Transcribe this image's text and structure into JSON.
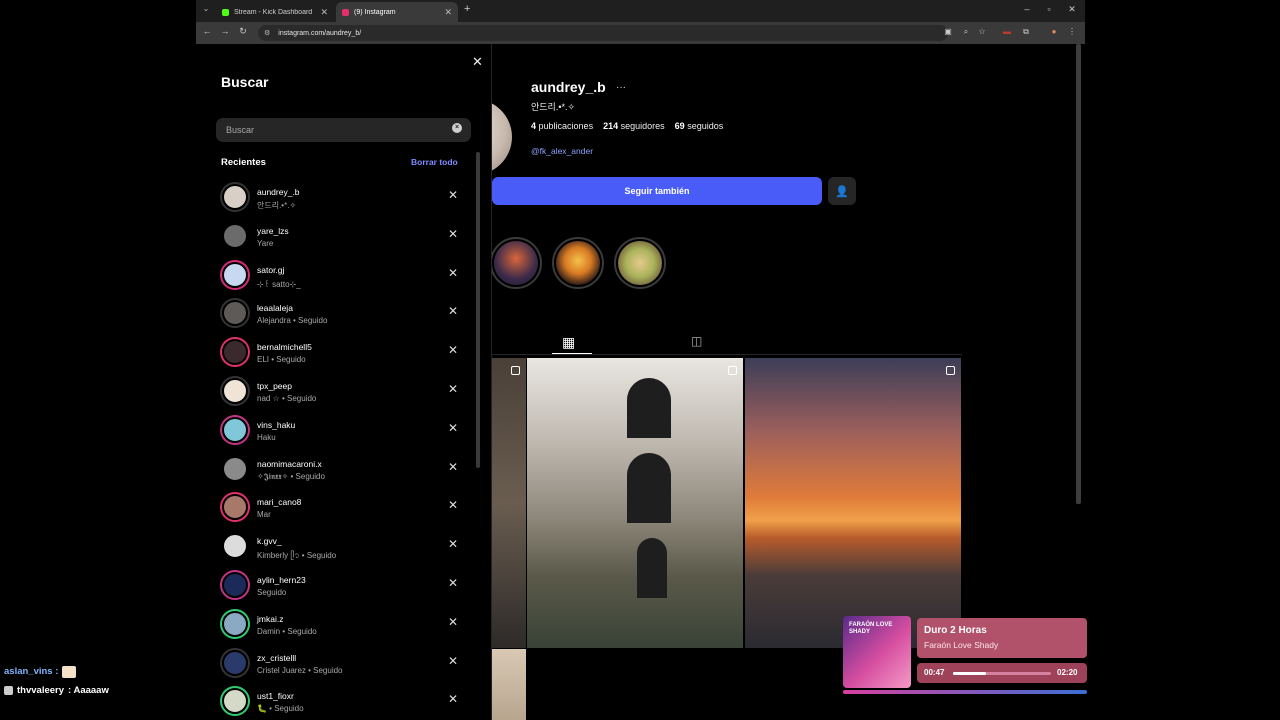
{
  "browser": {
    "tabs": [
      {
        "title": "Stream - Kick Dashboard",
        "favicon_color": "#53fc18"
      },
      {
        "title": "(9) Instagram",
        "favicon_color": "#e1306c"
      }
    ],
    "url": "instagram.com/aundrey_b/"
  },
  "search_panel": {
    "title": "Buscar",
    "search_placeholder": "Buscar",
    "recent_label": "Recientes",
    "clear_all_label": "Borrar todo",
    "recent": [
      {
        "user": "aundrey_.b",
        "sub": "안드리.•*.✧",
        "ring": "#333333",
        "color": "#d8cfc7"
      },
      {
        "user": "yare_lzs",
        "sub": "Yare",
        "ring": "#000000",
        "color": "#6b6b6b"
      },
      {
        "user": "sator.gj",
        "sub": "⊹꒰ satto⊹_",
        "ring": "#d62976",
        "color": "#c7d8f0"
      },
      {
        "user": "leaalaleja",
        "sub": "Alejandra • Seguido",
        "ring": "#333333",
        "color": "#5d5a58"
      },
      {
        "user": "bernalmichell5",
        "sub": "ELI • Seguido",
        "ring": "#e1306c",
        "color": "#3a2a2e"
      },
      {
        "user": "tpx_peep",
        "sub": "nad ☆ • Seguido",
        "ring": "#333333",
        "color": "#efe4d6"
      },
      {
        "user": "vins_haku",
        "sub": "Haku",
        "ring": "#c13584",
        "color": "#7fc7d9"
      },
      {
        "user": "naomimacaroni.x",
        "sub": "✧𝕵𝖎𝖓𝖝𝖝✧ • Seguido",
        "ring": "#000000",
        "color": "#8a8a8a"
      },
      {
        "user": "mari_cano8",
        "sub": "Mar",
        "ring": "#e1306c",
        "color": "#a8786a"
      },
      {
        "user": "k.gvv_",
        "sub": "Kimberly ᥫ᭡ • Seguido",
        "ring": "#000000",
        "color": "#dcdcdc"
      },
      {
        "user": "aylin_hern23",
        "sub": "Seguido",
        "ring": "#c13584",
        "color": "#1c2a5a"
      },
      {
        "user": "jmkai.z",
        "sub": "Damin • Seguido",
        "ring": "#2ecc71",
        "color": "#8aa9c2"
      },
      {
        "user": "zx_cristelll",
        "sub": "Cristel Juarez • Seguido",
        "ring": "#333333",
        "color": "#2a3a6a"
      },
      {
        "user": "ust1_fioxr",
        "sub": "🐛 • Seguido",
        "ring": "#2ecc71",
        "color": "#d5d9c8"
      }
    ]
  },
  "profile": {
    "username": "aundrey_.b",
    "display_name": "안드리.•*.✧",
    "posts_count": "4",
    "posts_label": "publicaciones",
    "followers_count": "214",
    "followers_label": "seguidores",
    "following_count": "69",
    "following_label": "seguidos",
    "mention": "@fk_alex_ander",
    "follow_button": "Seguir también"
  },
  "chat": [
    {
      "user": "aslan_vins",
      "separator": ":"
    },
    {
      "user": "thvvaleery",
      "message": ": Aaaaaw"
    }
  ],
  "music": {
    "art_text": "FARAÓN LOVE SHADY",
    "title": "Duro 2 Horas",
    "artist": "Faraón Love Shady",
    "elapsed": "00:47",
    "total": "02:20",
    "progress": 0.336
  }
}
